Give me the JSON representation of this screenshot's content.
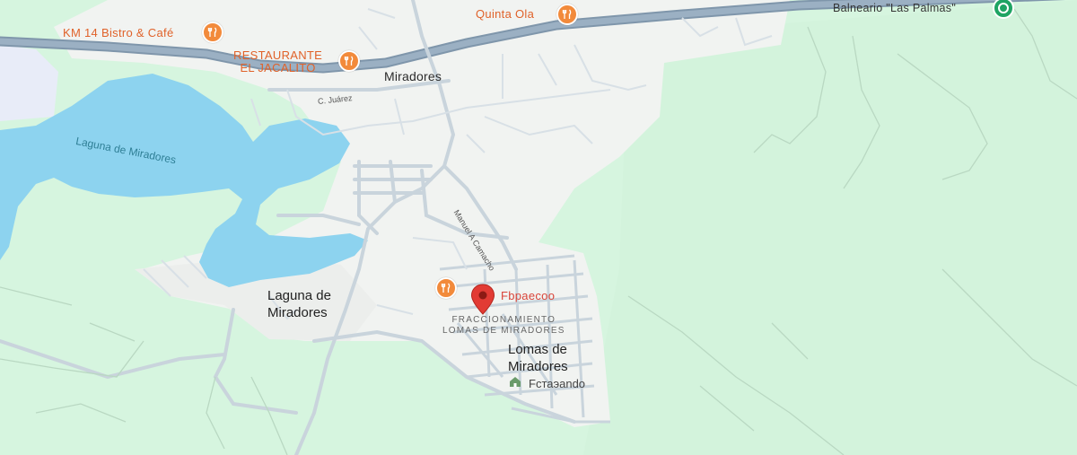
{
  "map": {
    "places": {
      "miradores": "Miradores",
      "laguna_town": "Laguna de\nMiradores",
      "lomas": "Lomas de\nMiradores"
    },
    "water": {
      "laguna": "Laguna de Miradores"
    },
    "streets": {
      "juarez": "C. Juárez",
      "camacho": "Manuel A Camacho"
    },
    "subdivision": "FRACCIONAMIENTO\nLOMAS DE MIRADORES",
    "pois": {
      "km14": "KM 14 Bistro & Café",
      "jacalito": "RESTAURANTE\nEL JACALITO",
      "quinta_ola": "Quinta Ola",
      "balneario": "Balneario \"Las Palmas\"",
      "selected_marker_label": "Fbpaecoo",
      "lodging_label": "Fстаэando"
    },
    "icons": {
      "restaurant": "restaurant-icon",
      "park": "park-icon",
      "selected": "map-pin-icon",
      "lodging": "home-icon"
    },
    "colors": {
      "land": "#d6f5df",
      "urban": "#f1f3f1",
      "water": "#8dd3ef",
      "highway": "#8fa6bb",
      "road": "#c7d3dc",
      "restaurant_pin": "#f28a3b",
      "park_pin": "#1fa463",
      "selected_pin": "#e23b34"
    }
  }
}
